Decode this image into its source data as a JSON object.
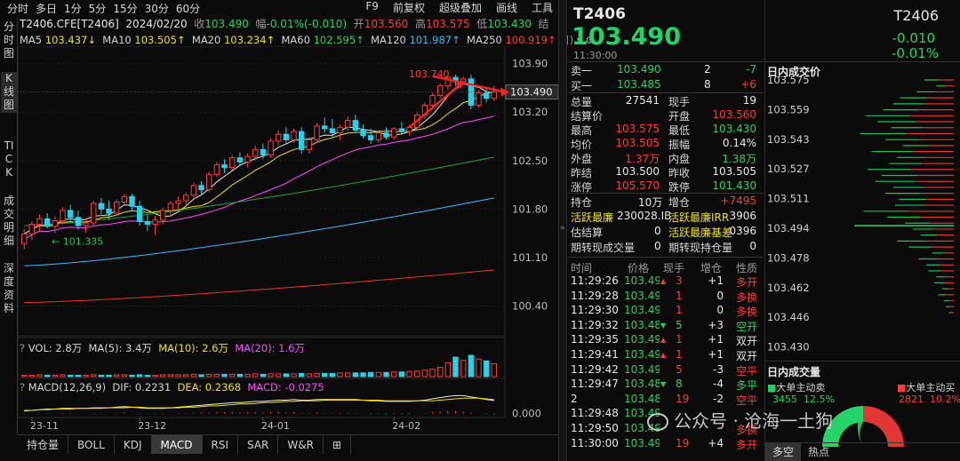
{
  "toolbar": {
    "tabs": [
      "分时",
      "多日",
      "1分",
      "5分",
      "15分",
      "30分",
      "60分"
    ],
    "right": [
      "F9",
      "前复权",
      "超级叠加",
      "画线",
      "工具"
    ]
  },
  "sidebar": [
    "分时图",
    "K线图",
    "TICK",
    "成交明细",
    "深度资料"
  ],
  "info": {
    "symbol": "T2406.CFE[T2406]",
    "date": "2024/02/20",
    "close_label": "收",
    "close": "103.490",
    "change_label": "幅",
    "change": "-0.01%(-0.010)",
    "open_label": "开",
    "open": "103.560",
    "high_label": "高",
    "high": "103.575",
    "low_label": "低",
    "low": "103.430",
    "end_label": "结"
  },
  "ma": [
    {
      "label": "MA5",
      "value": "103.437↓",
      "color": "#e8e8e8"
    },
    {
      "label": "MA10",
      "value": "103.505↑",
      "color": "#f2e200"
    },
    {
      "label": "MA20",
      "value": "103.234↑",
      "color": "#ff4dff"
    },
    {
      "label": "MA60",
      "value": "102.595↑",
      "color": "#22c55e"
    },
    {
      "label": "MA120",
      "value": "101.987↑",
      "color": "#38bdf8"
    },
    {
      "label": "MA250",
      "value": "100.919↑",
      "color": "#ff5555"
    }
  ],
  "ma_suffix": "日)",
  "chart_data": {
    "type": "candlestick",
    "x_ticks": [
      "23-11",
      "23-12",
      "24-01",
      "24-02"
    ],
    "price_axis": [
      "103.90",
      "103.20",
      "102.50",
      "101.80",
      "101.10",
      "100.40"
    ],
    "ylim": [
      100.2,
      104.05
    ],
    "current_price": "103.490",
    "annotations": {
      "high_marker": "103.740",
      "low_marker": "101.335"
    },
    "candles": [
      [
        101.3,
        101.52,
        101.22,
        101.44
      ],
      [
        101.44,
        101.62,
        101.35,
        101.58
      ],
      [
        101.58,
        101.72,
        101.48,
        101.66
      ],
      [
        101.66,
        101.74,
        101.52,
        101.55
      ],
      [
        101.55,
        101.7,
        101.45,
        101.63
      ],
      [
        101.63,
        101.82,
        101.58,
        101.78
      ],
      [
        101.78,
        101.86,
        101.62,
        101.68
      ],
      [
        101.68,
        101.78,
        101.5,
        101.56
      ],
      [
        101.56,
        101.66,
        101.46,
        101.6
      ],
      [
        101.6,
        101.92,
        101.56,
        101.88
      ],
      [
        101.88,
        101.96,
        101.72,
        101.8
      ],
      [
        101.8,
        101.92,
        101.66,
        101.74
      ],
      [
        101.74,
        101.94,
        101.7,
        101.9
      ],
      [
        101.9,
        102.02,
        101.84,
        101.98
      ],
      [
        101.98,
        102.02,
        101.78,
        101.84
      ],
      [
        101.84,
        101.92,
        101.56,
        101.62
      ],
      [
        101.62,
        101.72,
        101.48,
        101.58
      ],
      [
        101.58,
        101.7,
        101.42,
        101.64
      ],
      [
        101.64,
        101.82,
        101.58,
        101.78
      ],
      [
        101.78,
        101.92,
        101.7,
        101.88
      ],
      [
        101.88,
        101.98,
        101.8,
        101.92
      ],
      [
        101.92,
        102.04,
        101.86,
        102.0
      ],
      [
        102.0,
        102.18,
        101.96,
        102.14
      ],
      [
        102.14,
        102.2,
        102.02,
        102.08
      ],
      [
        102.08,
        102.34,
        102.04,
        102.3
      ],
      [
        102.3,
        102.48,
        102.26,
        102.44
      ],
      [
        102.44,
        102.52,
        102.32,
        102.4
      ],
      [
        102.4,
        102.58,
        102.36,
        102.54
      ],
      [
        102.54,
        102.62,
        102.42,
        102.48
      ],
      [
        102.48,
        102.6,
        102.4,
        102.56
      ],
      [
        102.56,
        102.72,
        102.5,
        102.66
      ],
      [
        102.66,
        102.74,
        102.52,
        102.58
      ],
      [
        102.58,
        102.82,
        102.54,
        102.78
      ],
      [
        102.78,
        102.94,
        102.72,
        102.88
      ],
      [
        102.88,
        102.98,
        102.74,
        102.8
      ],
      [
        102.8,
        102.96,
        102.76,
        102.92
      ],
      [
        102.92,
        102.98,
        102.6,
        102.66
      ],
      [
        102.66,
        102.84,
        102.6,
        102.8
      ],
      [
        102.8,
        103.04,
        102.78,
        103.0
      ],
      [
        103.0,
        103.12,
        102.9,
        102.96
      ],
      [
        102.96,
        103.1,
        102.84,
        102.9
      ],
      [
        102.9,
        103.02,
        102.8,
        102.98
      ],
      [
        102.98,
        103.14,
        102.92,
        103.08
      ],
      [
        103.08,
        103.16,
        102.9,
        102.94
      ],
      [
        102.94,
        103.02,
        102.82,
        102.86
      ],
      [
        102.86,
        102.96,
        102.74,
        102.8
      ],
      [
        102.8,
        102.94,
        102.76,
        102.9
      ],
      [
        102.9,
        102.98,
        102.8,
        102.84
      ],
      [
        102.84,
        102.98,
        102.8,
        102.96
      ],
      [
        102.96,
        103.06,
        102.88,
        102.92
      ],
      [
        102.92,
        103.02,
        102.86,
        102.98
      ],
      [
        102.98,
        103.2,
        102.94,
        103.16
      ],
      [
        103.16,
        103.34,
        103.1,
        103.3
      ],
      [
        103.3,
        103.48,
        103.24,
        103.44
      ],
      [
        103.44,
        103.62,
        103.4,
        103.58
      ],
      [
        103.58,
        103.74,
        103.52,
        103.7
      ],
      [
        103.7,
        103.74,
        103.58,
        103.64
      ],
      [
        103.64,
        103.72,
        103.6,
        103.68
      ],
      [
        103.68,
        103.74,
        103.24,
        103.3
      ],
      [
        103.3,
        103.52,
        103.26,
        103.48
      ],
      [
        103.48,
        103.56,
        103.34,
        103.4
      ],
      [
        103.4,
        103.58,
        103.36,
        103.49
      ]
    ],
    "volume_header": {
      "vol": "VOL: 2.8万",
      "ma5": "MA(5): 3.4万",
      "ma10": "MA(10): 2.6万",
      "ma20": "MA(20): 1.6万"
    },
    "volume": [
      0.3,
      0.3,
      0.4,
      0.3,
      0.3,
      0.4,
      0.3,
      0.3,
      0.3,
      0.4,
      0.3,
      0.3,
      0.4,
      0.4,
      0.3,
      0.4,
      0.3,
      0.3,
      0.4,
      0.4,
      0.4,
      0.4,
      0.5,
      0.4,
      0.5,
      0.5,
      0.5,
      0.5,
      0.5,
      0.5,
      0.6,
      0.5,
      0.6,
      0.6,
      0.6,
      0.6,
      0.7,
      0.6,
      0.7,
      0.7,
      0.7,
      0.8,
      0.8,
      0.8,
      0.8,
      0.9,
      0.9,
      0.9,
      1.0,
      1.0,
      1.1,
      1.2,
      1.4,
      1.6,
      2.0,
      3.0,
      4.2,
      3.5,
      4.6,
      3.8,
      3.4,
      2.8
    ],
    "macd_header": {
      "title": "MACD(12,26,9)",
      "dif": "DIF: 0.2231",
      "dea": "DEA: 0.2368",
      "macd": "MACD: -0.0275"
    },
    "macd_axis": "0.000",
    "dif": [
      0.06,
      0.07,
      0.08,
      0.09,
      0.09,
      0.1,
      0.1,
      0.1,
      0.1,
      0.11,
      0.11,
      0.11,
      0.12,
      0.13,
      0.12,
      0.11,
      0.1,
      0.1,
      0.1,
      0.11,
      0.12,
      0.13,
      0.14,
      0.15,
      0.16,
      0.17,
      0.18,
      0.19,
      0.19,
      0.2,
      0.21,
      0.21,
      0.22,
      0.23,
      0.23,
      0.24,
      0.23,
      0.23,
      0.24,
      0.24,
      0.24,
      0.24,
      0.24,
      0.24,
      0.23,
      0.22,
      0.22,
      0.21,
      0.21,
      0.21,
      0.21,
      0.22,
      0.23,
      0.25,
      0.27,
      0.29,
      0.3,
      0.3,
      0.28,
      0.26,
      0.24,
      0.223
    ],
    "dea": [
      0.07,
      0.07,
      0.08,
      0.08,
      0.09,
      0.09,
      0.09,
      0.1,
      0.1,
      0.1,
      0.1,
      0.11,
      0.11,
      0.11,
      0.12,
      0.12,
      0.11,
      0.11,
      0.11,
      0.11,
      0.11,
      0.12,
      0.12,
      0.13,
      0.14,
      0.14,
      0.15,
      0.16,
      0.17,
      0.17,
      0.18,
      0.19,
      0.19,
      0.2,
      0.21,
      0.21,
      0.22,
      0.22,
      0.22,
      0.23,
      0.23,
      0.23,
      0.23,
      0.23,
      0.23,
      0.23,
      0.23,
      0.22,
      0.22,
      0.22,
      0.22,
      0.22,
      0.22,
      0.22,
      0.23,
      0.24,
      0.25,
      0.26,
      0.26,
      0.26,
      0.25,
      0.237
    ]
  },
  "bottom_tabs": [
    "持仓量",
    "BOLL",
    "KDJ",
    "MACD",
    "RSI",
    "SAR",
    "W&R",
    "⊞"
  ],
  "active_tab": "MACD",
  "quote": {
    "code": "T2406",
    "price": "103.490",
    "time": "11:30:00",
    "ask": {
      "label": "卖一",
      "price": "103.490",
      "vol": "2",
      "chg": "-7"
    },
    "bid": {
      "label": "买一",
      "price": "103.485",
      "vol": "8",
      "chg": "+6"
    },
    "stats": [
      {
        "l1": "总量",
        "v1": "27541",
        "c1": "white",
        "l2": "现手",
        "v2": "19",
        "c2": "white"
      },
      {
        "l1": "结算价",
        "v1": "",
        "c1": "white",
        "l2": "开盘",
        "v2": "103.560",
        "c2": "red"
      },
      {
        "l1": "最高",
        "v1": "103.575",
        "c1": "red",
        "l2": "最低",
        "v2": "103.430",
        "c2": "green"
      },
      {
        "l1": "均价",
        "v1": "103.505",
        "c1": "red",
        "l2": "振幅",
        "v2": "0.14%",
        "c2": "white"
      },
      {
        "l1": "外盘",
        "v1": "1.37万",
        "c1": "red",
        "l2": "内盘",
        "v2": "1.38万",
        "c2": "green"
      },
      {
        "l1": "昨结",
        "v1": "103.500",
        "c1": "white",
        "l2": "昨收",
        "v2": "103.505",
        "c2": "white"
      },
      {
        "l1": "涨停",
        "v1": "105.570",
        "c1": "red",
        "l2": "跌停",
        "v2": "101.430",
        "c2": "green"
      }
    ],
    "oi": {
      "l1": "持仓",
      "v1": "10万",
      "l2": "增仓",
      "v2": "+7495"
    },
    "active": {
      "l1": "活跃最廉",
      "v1": "230028.IB",
      "l2": "活跃最廉IRR",
      "v2": "3906"
    },
    "est": {
      "l1": "估结算",
      "v1": "0",
      "l2": "活跃最廉基差",
      "v2": "0396"
    },
    "delivery": {
      "l1": "期转现成交量",
      "v1": "0",
      "l2": "期转现持仓量",
      "v2": "0"
    },
    "ticks_header": [
      "时间",
      "价格",
      "现手",
      "增仓",
      "性质"
    ],
    "ticks": [
      {
        "time": "11:29:26",
        "price": "103.49",
        "dir": "up",
        "vol": "3",
        "chg": "+1",
        "type": "多开",
        "tc": "red"
      },
      {
        "time": "11:29:28",
        "price": "103.49",
        "dir": "",
        "vol": "1",
        "chg": "0",
        "type": "多换",
        "tc": "red"
      },
      {
        "time": "11:29:30",
        "price": "103.49",
        "dir": "",
        "vol": "1",
        "chg": "0",
        "type": "多换",
        "tc": "red"
      },
      {
        "time": "11:29:32",
        "price": "103.48",
        "dir": "down",
        "vol": "5",
        "chg": "+3",
        "type": "空开",
        "tc": "green"
      },
      {
        "time": "11:29:35",
        "price": "103.49",
        "dir": "up",
        "vol": "1",
        "chg": "+1",
        "type": "双开",
        "tc": "white"
      },
      {
        "time": "11:29:41",
        "price": "103.49",
        "dir": "up",
        "vol": "1",
        "chg": "+1",
        "type": "双开",
        "tc": "white"
      },
      {
        "time": "11:29:42",
        "price": "103.49",
        "dir": "",
        "vol": "5",
        "chg": "-3",
        "type": "空平",
        "tc": "red"
      },
      {
        "time": "11:29:47",
        "price": "103.48",
        "dir": "down",
        "vol": "8",
        "chg": "-4",
        "type": "多平",
        "tc": "green"
      },
      {
        "time": "2",
        "price": "103.48",
        "dir": "",
        "vol": "19",
        "chg": "-2",
        "type": "空平",
        "tc": "red"
      },
      {
        "time": "11:29:48",
        "price": "103.49",
        "dir": "",
        "vol": "",
        "chg": "",
        "type": "",
        "tc": "white"
      },
      {
        "time": "11:29:50",
        "price": "103.49",
        "dir": "",
        "vol": "",
        "chg": "",
        "type": "多换",
        "tc": "red"
      },
      {
        "time": "11:30:00",
        "price": "103.49",
        "dir": "",
        "vol": "19",
        "chg": "+4",
        "type": "多开",
        "tc": "red"
      }
    ]
  },
  "profile": {
    "code": "T2406",
    "chg": "-0.010",
    "pct": "-0.01%",
    "title": "日内成交价",
    "levels": [
      "103.575",
      "103.559",
      "103.543",
      "103.527",
      "103.511",
      "103.494",
      "103.478",
      "103.462",
      "103.446",
      "103.430"
    ],
    "bars": [
      0.3,
      0.18,
      0.38,
      0.55,
      0.62,
      0.72,
      0.9,
      0.78,
      0.64,
      0.96,
      0.7,
      0.52,
      0.84,
      0.58,
      0.66,
      0.88,
      0.74,
      0.8,
      0.62,
      0.7,
      0.56,
      0.6,
      0.92,
      0.68,
      0.5,
      0.42,
      0.34,
      0.58,
      0.46,
      0.22,
      0.36,
      0.28,
      0.26,
      0.18,
      0.2,
      0.12,
      0.16,
      0.1,
      0.08,
      0.05
    ],
    "vol_title": "日内成交量",
    "sell": {
      "label": "大单主动卖",
      "value": "3455",
      "pct": "12.5%"
    },
    "buy": {
      "label": "大单主动买",
      "value": "2821",
      "pct": "10.2%"
    },
    "tabs": [
      "多空",
      "热点"
    ],
    "watermark": "公众号 · 沧海一土狗"
  }
}
